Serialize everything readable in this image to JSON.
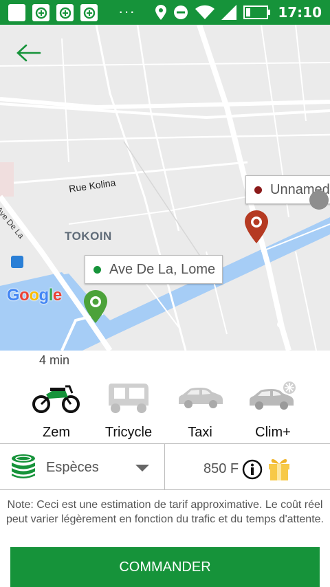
{
  "status_bar": {
    "time": "17:10",
    "dots": "···"
  },
  "map": {
    "street_label": "Rue Kolina",
    "avenue_label": "Ave De La",
    "district_label": "TOKOIN",
    "google_letters": [
      "G",
      "o",
      "o",
      "g",
      "l",
      "e"
    ],
    "pickup": {
      "address": "Ave De La, Lome",
      "dot_color": "#16933a"
    },
    "destination": {
      "address": "Unnamed",
      "dot_color": "#8b1a1a"
    }
  },
  "eta": "4 min",
  "vehicles": [
    {
      "label": "Zem",
      "icon": "motorcycle-icon",
      "selected": true
    },
    {
      "label": "Tricycle",
      "icon": "tricycle-icon",
      "selected": false
    },
    {
      "label": "Taxi",
      "icon": "car-icon",
      "selected": false
    },
    {
      "label": "Clim+",
      "icon": "ac-car-icon",
      "selected": false
    }
  ],
  "payment": {
    "method": "Espèces",
    "price": "850 F"
  },
  "note": "Note: Ceci est une estimation de tarif approximative. Le coût réel peut varier légèrement en fonction du trafic et du temps d'attente.",
  "order_button": "COMMANDER",
  "colors": {
    "brand": "#16933a",
    "dest_pin": "#b53a22",
    "google_blue": "#4285f4",
    "google_red": "#ea4335",
    "google_yellow": "#fbbc05",
    "google_green": "#34a853"
  }
}
